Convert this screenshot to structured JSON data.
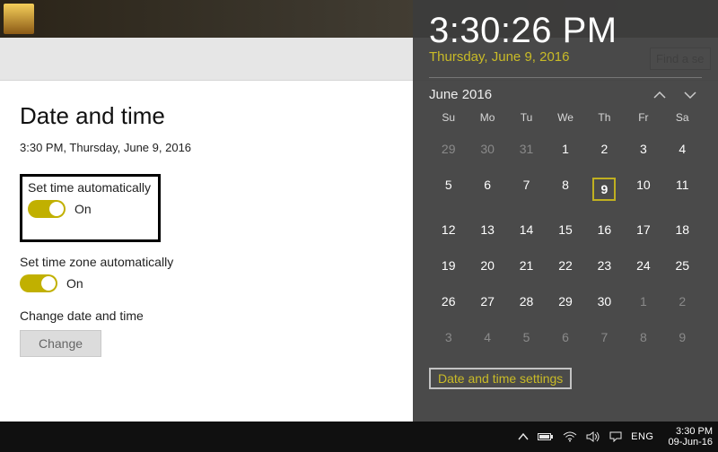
{
  "topbar": {
    "search_placeholder": "Find a se"
  },
  "settings": {
    "title": "Date and time",
    "current": "3:30 PM, Thursday, June 9, 2016",
    "set_time_auto_label": "Set time automatically",
    "set_time_auto_state": "On",
    "set_zone_auto_label": "Set time zone automatically",
    "set_zone_auto_state": "On",
    "change_label": "Change date and time",
    "change_button": "Change"
  },
  "flyout": {
    "time": "3:30:26 PM",
    "date": "Thursday, June 9, 2016",
    "month": "June 2016",
    "dow": [
      "Su",
      "Mo",
      "Tu",
      "We",
      "Th",
      "Fr",
      "Sa"
    ],
    "weeks": [
      [
        {
          "n": "29",
          "dim": true
        },
        {
          "n": "30",
          "dim": true
        },
        {
          "n": "31",
          "dim": true
        },
        {
          "n": "1"
        },
        {
          "n": "2"
        },
        {
          "n": "3"
        },
        {
          "n": "4"
        }
      ],
      [
        {
          "n": "5"
        },
        {
          "n": "6"
        },
        {
          "n": "7"
        },
        {
          "n": "8"
        },
        {
          "n": "9",
          "today": true
        },
        {
          "n": "10"
        },
        {
          "n": "11"
        }
      ],
      [
        {
          "n": "12"
        },
        {
          "n": "13"
        },
        {
          "n": "14"
        },
        {
          "n": "15"
        },
        {
          "n": "16"
        },
        {
          "n": "17"
        },
        {
          "n": "18"
        }
      ],
      [
        {
          "n": "19"
        },
        {
          "n": "20"
        },
        {
          "n": "21"
        },
        {
          "n": "22"
        },
        {
          "n": "23"
        },
        {
          "n": "24"
        },
        {
          "n": "25"
        }
      ],
      [
        {
          "n": "26"
        },
        {
          "n": "27"
        },
        {
          "n": "28"
        },
        {
          "n": "29"
        },
        {
          "n": "30"
        },
        {
          "n": "1",
          "dim": true
        },
        {
          "n": "2",
          "dim": true
        }
      ],
      [
        {
          "n": "3",
          "dim": true
        },
        {
          "n": "4",
          "dim": true
        },
        {
          "n": "5",
          "dim": true
        },
        {
          "n": "6",
          "dim": true
        },
        {
          "n": "7",
          "dim": true
        },
        {
          "n": "8",
          "dim": true
        },
        {
          "n": "9",
          "dim": true
        }
      ]
    ],
    "settings_link": "Date and time settings"
  },
  "taskbar": {
    "lang": "ENG",
    "clock_time": "3:30 PM",
    "clock_date": "09-Jun-16"
  }
}
